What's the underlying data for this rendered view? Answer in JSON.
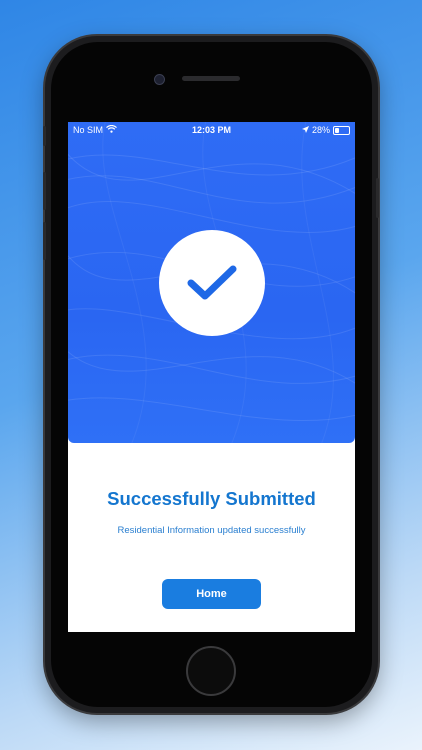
{
  "status_bar": {
    "carrier": "No SIM",
    "time": "12:03 PM",
    "battery": "28%",
    "battery_level": 0.28
  },
  "main": {
    "title": "Successfully Submitted",
    "subtitle": "Residential Information updated successfully",
    "home_button_label": "Home"
  },
  "icons": {
    "status": "checkmark-icon",
    "signal": "wifi-icon",
    "location": "location-arrow-icon",
    "battery": "battery-icon"
  },
  "colors": {
    "hero_blue": "#2a66f2",
    "title_blue": "#1476cf",
    "button_blue": "#1a7de0"
  }
}
